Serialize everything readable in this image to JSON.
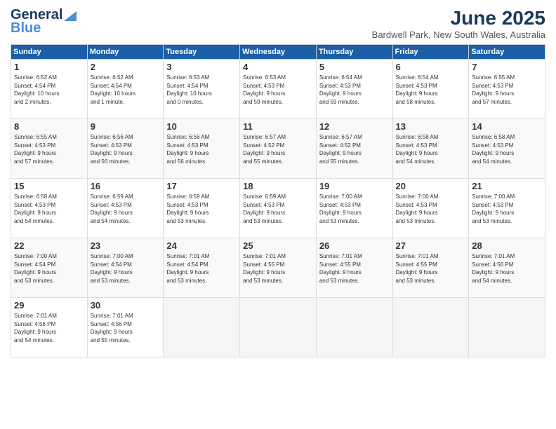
{
  "header": {
    "logo_line1": "General",
    "logo_line2": "Blue",
    "month": "June 2025",
    "location": "Bardwell Park, New South Wales, Australia"
  },
  "days_of_week": [
    "Sunday",
    "Monday",
    "Tuesday",
    "Wednesday",
    "Thursday",
    "Friday",
    "Saturday"
  ],
  "weeks": [
    [
      {
        "day": "1",
        "info": "Sunrise: 6:52 AM\nSunset: 4:54 PM\nDaylight: 10 hours\nand 2 minutes."
      },
      {
        "day": "2",
        "info": "Sunrise: 6:52 AM\nSunset: 4:54 PM\nDaylight: 10 hours\nand 1 minute."
      },
      {
        "day": "3",
        "info": "Sunrise: 6:53 AM\nSunset: 4:54 PM\nDaylight: 10 hours\nand 0 minutes."
      },
      {
        "day": "4",
        "info": "Sunrise: 6:53 AM\nSunset: 4:53 PM\nDaylight: 9 hours\nand 59 minutes."
      },
      {
        "day": "5",
        "info": "Sunrise: 6:54 AM\nSunset: 4:53 PM\nDaylight: 9 hours\nand 59 minutes."
      },
      {
        "day": "6",
        "info": "Sunrise: 6:54 AM\nSunset: 4:53 PM\nDaylight: 9 hours\nand 58 minutes."
      },
      {
        "day": "7",
        "info": "Sunrise: 6:55 AM\nSunset: 4:53 PM\nDaylight: 9 hours\nand 57 minutes."
      }
    ],
    [
      {
        "day": "8",
        "info": "Sunrise: 6:55 AM\nSunset: 4:53 PM\nDaylight: 9 hours\nand 57 minutes."
      },
      {
        "day": "9",
        "info": "Sunrise: 6:56 AM\nSunset: 4:53 PM\nDaylight: 9 hours\nand 56 minutes."
      },
      {
        "day": "10",
        "info": "Sunrise: 6:56 AM\nSunset: 4:53 PM\nDaylight: 9 hours\nand 56 minutes."
      },
      {
        "day": "11",
        "info": "Sunrise: 6:57 AM\nSunset: 4:52 PM\nDaylight: 9 hours\nand 55 minutes."
      },
      {
        "day": "12",
        "info": "Sunrise: 6:57 AM\nSunset: 4:52 PM\nDaylight: 9 hours\nand 55 minutes."
      },
      {
        "day": "13",
        "info": "Sunrise: 6:58 AM\nSunset: 4:53 PM\nDaylight: 9 hours\nand 54 minutes."
      },
      {
        "day": "14",
        "info": "Sunrise: 6:58 AM\nSunset: 4:53 PM\nDaylight: 9 hours\nand 54 minutes."
      }
    ],
    [
      {
        "day": "15",
        "info": "Sunrise: 6:58 AM\nSunset: 4:53 PM\nDaylight: 9 hours\nand 54 minutes."
      },
      {
        "day": "16",
        "info": "Sunrise: 6:59 AM\nSunset: 4:53 PM\nDaylight: 9 hours\nand 54 minutes."
      },
      {
        "day": "17",
        "info": "Sunrise: 6:59 AM\nSunset: 4:53 PM\nDaylight: 9 hours\nand 53 minutes."
      },
      {
        "day": "18",
        "info": "Sunrise: 6:59 AM\nSunset: 4:53 PM\nDaylight: 9 hours\nand 53 minutes."
      },
      {
        "day": "19",
        "info": "Sunrise: 7:00 AM\nSunset: 4:53 PM\nDaylight: 9 hours\nand 53 minutes."
      },
      {
        "day": "20",
        "info": "Sunrise: 7:00 AM\nSunset: 4:53 PM\nDaylight: 9 hours\nand 53 minutes."
      },
      {
        "day": "21",
        "info": "Sunrise: 7:00 AM\nSunset: 4:53 PM\nDaylight: 9 hours\nand 53 minutes."
      }
    ],
    [
      {
        "day": "22",
        "info": "Sunrise: 7:00 AM\nSunset: 4:54 PM\nDaylight: 9 hours\nand 53 minutes."
      },
      {
        "day": "23",
        "info": "Sunrise: 7:00 AM\nSunset: 4:54 PM\nDaylight: 9 hours\nand 53 minutes."
      },
      {
        "day": "24",
        "info": "Sunrise: 7:01 AM\nSunset: 4:54 PM\nDaylight: 9 hours\nand 53 minutes."
      },
      {
        "day": "25",
        "info": "Sunrise: 7:01 AM\nSunset: 4:55 PM\nDaylight: 9 hours\nand 53 minutes."
      },
      {
        "day": "26",
        "info": "Sunrise: 7:01 AM\nSunset: 4:55 PM\nDaylight: 9 hours\nand 53 minutes."
      },
      {
        "day": "27",
        "info": "Sunrise: 7:01 AM\nSunset: 4:55 PM\nDaylight: 9 hours\nand 53 minutes."
      },
      {
        "day": "28",
        "info": "Sunrise: 7:01 AM\nSunset: 4:56 PM\nDaylight: 9 hours\nand 54 minutes."
      }
    ],
    [
      {
        "day": "29",
        "info": "Sunrise: 7:01 AM\nSunset: 4:56 PM\nDaylight: 9 hours\nand 54 minutes."
      },
      {
        "day": "30",
        "info": "Sunrise: 7:01 AM\nSunset: 4:56 PM\nDaylight: 9 hours\nand 55 minutes."
      },
      {
        "day": "",
        "info": ""
      },
      {
        "day": "",
        "info": ""
      },
      {
        "day": "",
        "info": ""
      },
      {
        "day": "",
        "info": ""
      },
      {
        "day": "",
        "info": ""
      }
    ]
  ]
}
